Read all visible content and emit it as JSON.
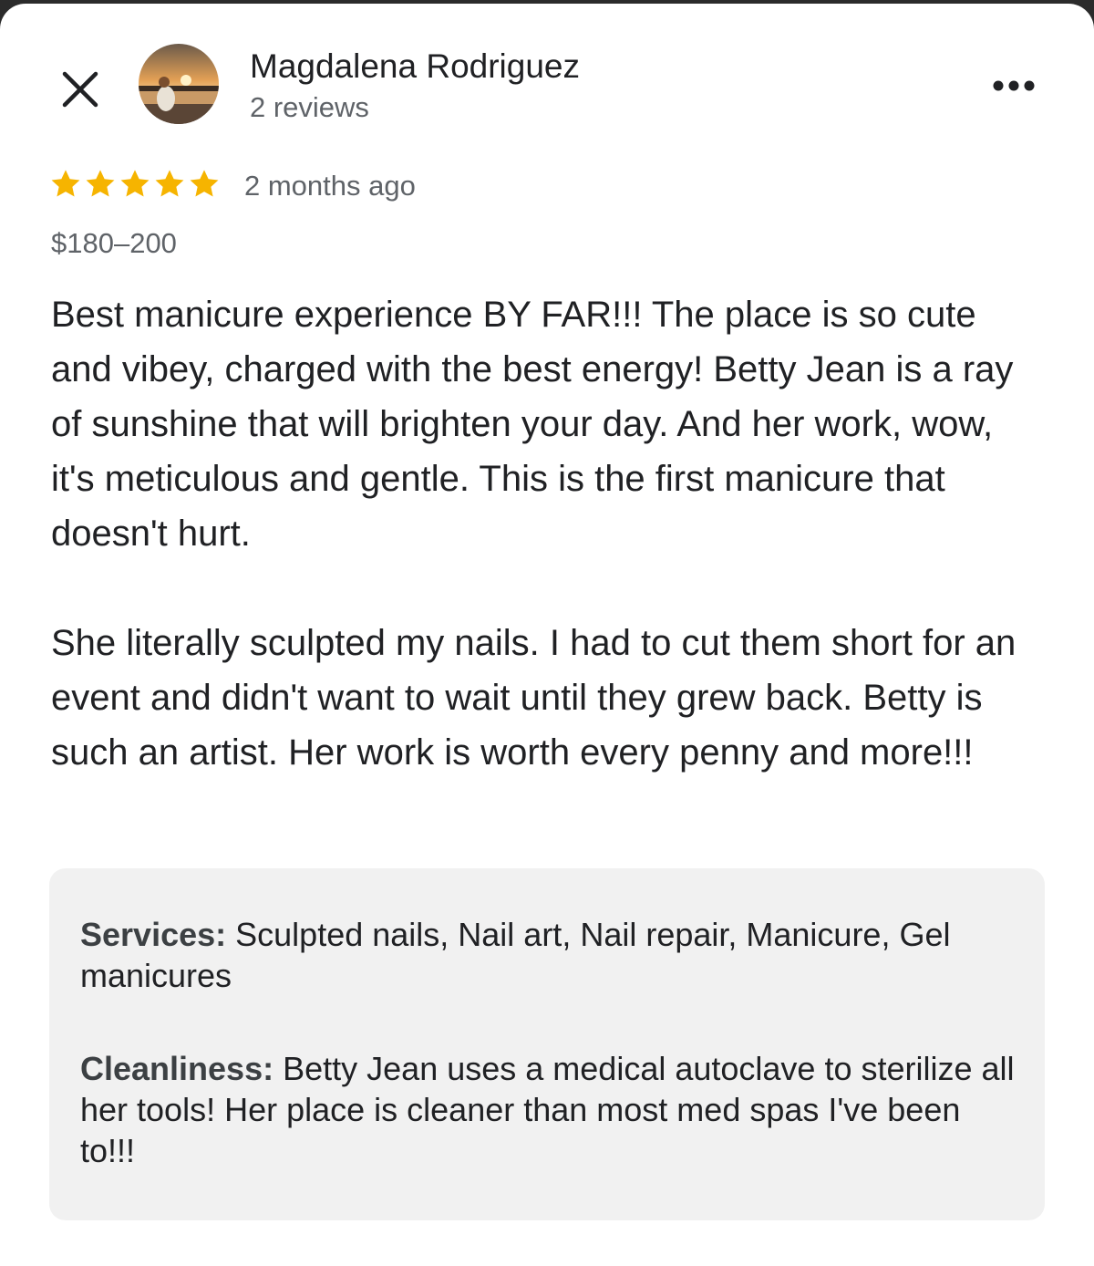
{
  "reviewer": {
    "name": "Magdalena Rodriguez",
    "reviews_count": "2 reviews"
  },
  "review": {
    "rating": 5,
    "rating_max": 5,
    "time_ago": "2 months ago",
    "price": "$180–200",
    "paragraphs": [
      "Best manicure experience BY FAR!!! The place is so cute and vibey, charged with the best energy! Betty Jean is a ray of sunshine that will brighten your day. And her work, wow, it's meticulous and gentle. This is the first manicure that doesn't hurt.",
      "She literally sculpted my nails. I had to cut them short for an event and didn't want to wait until they grew back. Betty is such an artist. Her work is worth every penny and more!!!"
    ]
  },
  "attributes": [
    {
      "label": "Services:",
      "value": "Sculpted nails, Nail art, Nail repair, Manicure, Gel manicures"
    },
    {
      "label": "Cleanliness:",
      "value": "Betty Jean uses a medical autoclave to sterilize all her tools! Her place is cleaner than most med spas I've been to!!!"
    }
  ],
  "icons": {
    "close": "close-icon",
    "more": "more-options-icon",
    "star": "star-icon"
  },
  "colors": {
    "star": "#f6b400",
    "secondary_text": "#5f6368",
    "attribute_box": "#f1f1f1"
  }
}
